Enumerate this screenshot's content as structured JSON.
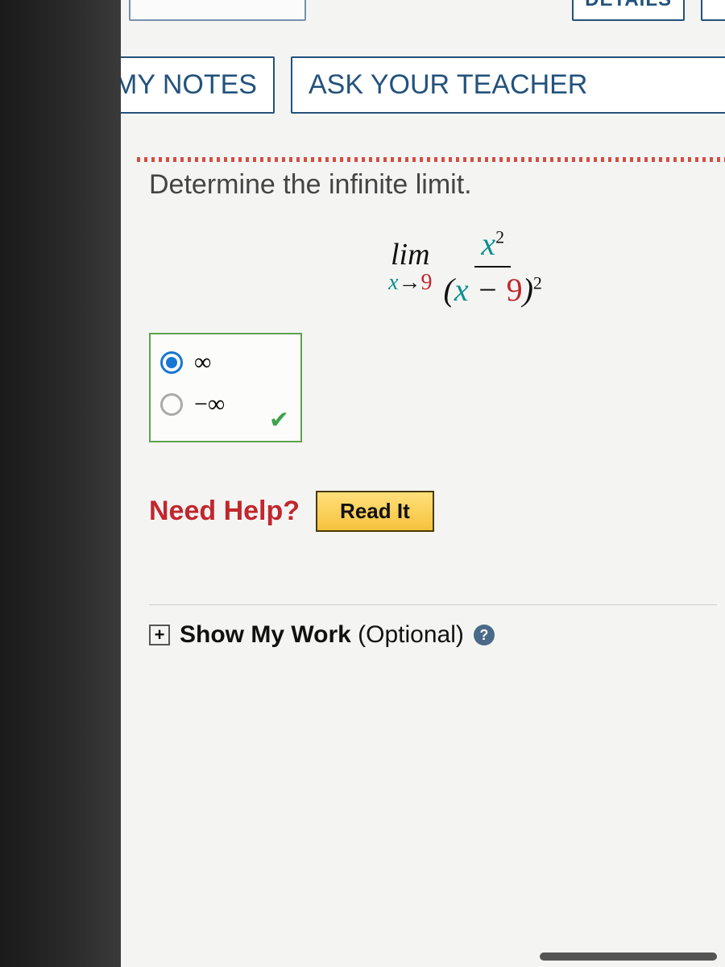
{
  "top_partial": {
    "details": "DETAILS"
  },
  "nav": {
    "my_notes": "MY NOTES",
    "ask_teacher": "ASK YOUR TEACHER"
  },
  "question": {
    "prompt": "Determine the infinite limit.",
    "limit": {
      "lim_label": "lim",
      "var": "x",
      "arrow": "→",
      "approach": "9",
      "numerator_base": "x",
      "numerator_exp": "2",
      "denominator_open": "(",
      "denominator_var": "x",
      "denominator_minus": " − ",
      "denominator_const": "9",
      "denominator_close": ")",
      "denominator_exp": "2"
    },
    "options": {
      "opt1": "∞",
      "opt2": "−∞",
      "selected_index": 0
    }
  },
  "help": {
    "label": "Need Help?",
    "read_it": "Read It"
  },
  "show_work": {
    "plus": "+",
    "bold": "Show My Work",
    "tail": " (Optional)",
    "q": "?"
  }
}
